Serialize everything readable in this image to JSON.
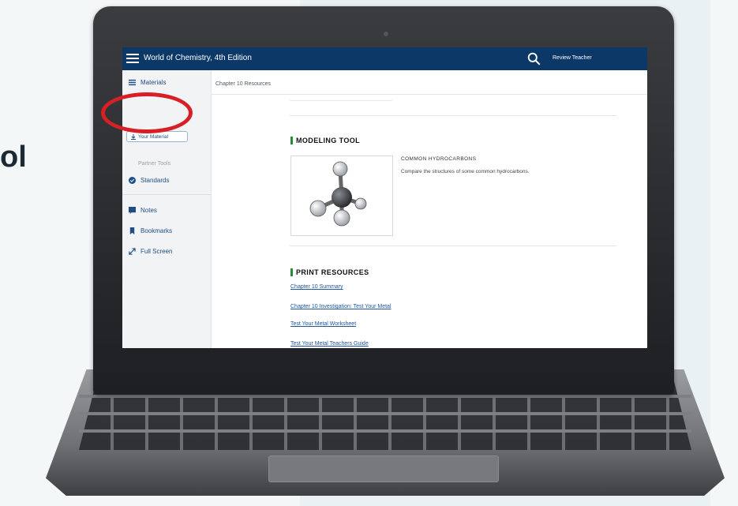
{
  "background": {
    "partial_text": "ol"
  },
  "app": {
    "title": "World of Chemistry, 4th Edition",
    "user": "Review Teacher",
    "accent_color": "#0c3868"
  },
  "sidebar": {
    "materials": "Materials",
    "upload_label": "Your Material",
    "sub_label": "Partner Tools",
    "standards": "Standards",
    "notes": "Notes",
    "bookmarks": "Bookmarks",
    "fullscreen": "Full Screen"
  },
  "breadcrumb": "Chapter 10 Resources",
  "modeling": {
    "heading": "MODELING TOOL",
    "tool_title": "COMMON HYDROCARBONS",
    "tool_desc": "Compare the structures of some common hydrocarbons."
  },
  "print": {
    "heading": "PRINT RESOURCES",
    "links": [
      "Chapter 10 Summary",
      "Chapter 10 Investigation: Test Your Metal",
      "Test Your Metal Worksheet",
      "Test Your Metal Teachers Guide"
    ]
  },
  "icons": [
    "menu-icon",
    "search-icon",
    "list-icon",
    "upload-icon",
    "check-circle-icon",
    "note-icon",
    "bookmark-icon",
    "expand-icon",
    "methane-molecule-icon"
  ],
  "annotation_color": "#d81f26"
}
